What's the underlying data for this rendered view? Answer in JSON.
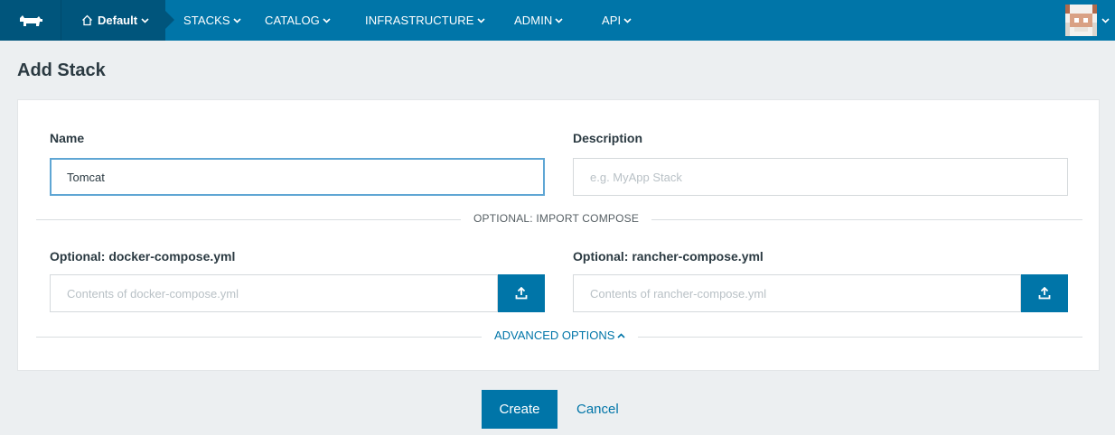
{
  "colors": {
    "nav_bg": "#0075a8",
    "nav_dark": "#00557c",
    "accent": "#0075a8",
    "page_bg": "#eceff1"
  },
  "nav": {
    "logo_icon": "cow-logo-icon",
    "environment": "Default",
    "items": [
      {
        "label": "STACKS"
      },
      {
        "label": "CATALOG"
      },
      {
        "label": "INFRASTRUCTURE"
      },
      {
        "label": "ADMIN"
      },
      {
        "label": "API"
      }
    ],
    "avatar_icon": "user-avatar-icon"
  },
  "page": {
    "title": "Add Stack"
  },
  "form": {
    "name_label": "Name",
    "name_value": "Tomcat",
    "description_label": "Description",
    "description_placeholder": "e.g. MyApp Stack",
    "import_divider": "OPTIONAL: IMPORT COMPOSE",
    "docker_label": "Optional: docker-compose.yml",
    "docker_placeholder": "Contents of docker-compose.yml",
    "rancher_label": "Optional: rancher-compose.yml",
    "rancher_placeholder": "Contents of rancher-compose.yml",
    "upload_icon": "upload-icon",
    "advanced_label": "ADVANCED OPTIONS"
  },
  "actions": {
    "create": "Create",
    "cancel": "Cancel"
  }
}
